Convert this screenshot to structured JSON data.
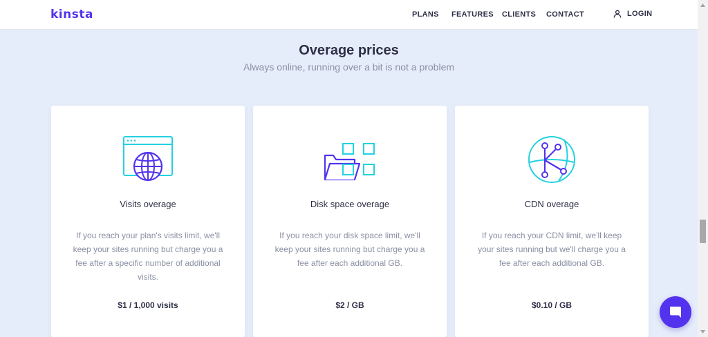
{
  "header": {
    "logo": "kinsta",
    "nav": [
      {
        "label": "PLANS"
      },
      {
        "label": "FEATURES"
      },
      {
        "label": "CLIENTS"
      },
      {
        "label": "CONTACT"
      }
    ],
    "login_label": "LOGIN"
  },
  "section": {
    "title": "Overage prices",
    "subtitle": "Always online, running over a bit is not a problem"
  },
  "cards": [
    {
      "icon": "browser-globe-icon",
      "title": "Visits overage",
      "description": "If you reach your plan's visits limit, we'll keep your sites running but charge you a fee after a specific number of additional visits.",
      "price": "$1 / 1,000 visits"
    },
    {
      "icon": "folder-files-icon",
      "title": "Disk space overage",
      "description": "If you reach your disk space limit, we'll keep your sites running but charge you a fee after each additional GB.",
      "price": "$2 / GB"
    },
    {
      "icon": "cdn-network-icon",
      "title": "CDN overage",
      "description": "If you reach your CDN limit, we'll keep your sites running but we'll charge you a fee after each additional GB.",
      "price": "$0.10 / GB"
    }
  ],
  "colors": {
    "brand": "#5333ed",
    "accent": "#24d2e0",
    "background": "#e6edfa",
    "text": "#2f3047",
    "muted": "#8a8fa3"
  }
}
